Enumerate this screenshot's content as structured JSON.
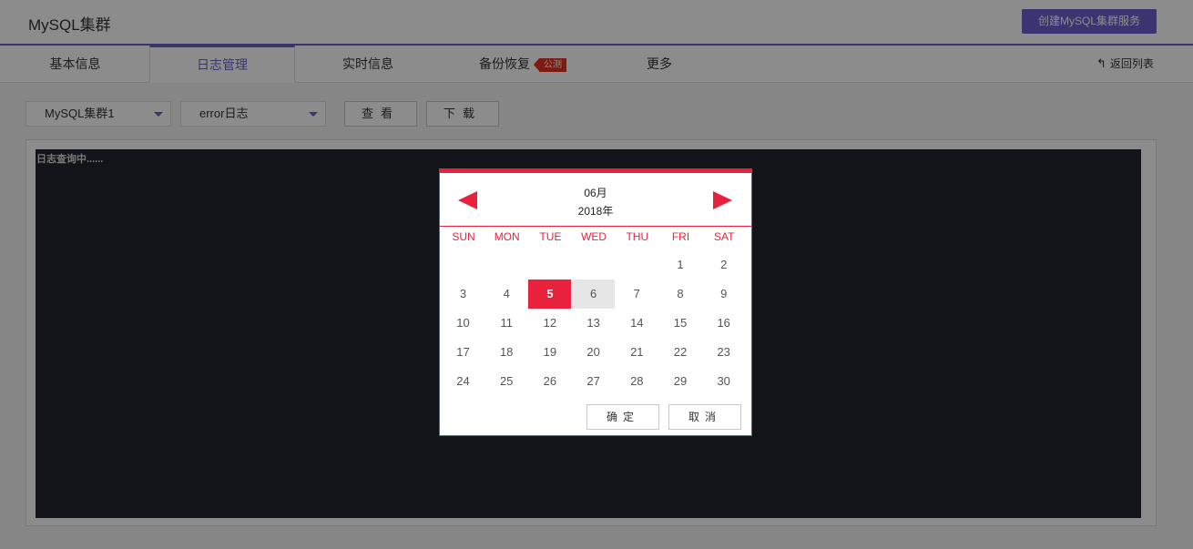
{
  "header": {
    "title": "MySQL集群",
    "create_button": "创建MySQL集群服务"
  },
  "tabs": [
    {
      "label": "基本信息",
      "active": false
    },
    {
      "label": "日志管理",
      "active": true
    },
    {
      "label": "实时信息",
      "active": false
    },
    {
      "label": "备份恢复",
      "active": false,
      "badge": "公测"
    },
    {
      "label": "更多",
      "active": false
    }
  ],
  "back_link": {
    "icon": "return-arrow-icon",
    "label": "返回列表"
  },
  "toolbar": {
    "cluster_select": "MySQL集群1",
    "log_type_select": "error日志",
    "view_button": "查看",
    "download_button": "下载"
  },
  "log": {
    "status_text": "日志查询中......"
  },
  "colors": {
    "accent": "#6b63c6",
    "calendar_red": "#e8223c",
    "log_bg": "#242631"
  },
  "calendar": {
    "month": "06月",
    "year": "2018年",
    "weekdays": [
      "SUN",
      "MON",
      "TUE",
      "WED",
      "THU",
      "FRI",
      "SAT"
    ],
    "weeks": [
      [
        "",
        "",
        "",
        "",
        "",
        "1",
        "2"
      ],
      [
        "3",
        "4",
        "5",
        "6",
        "7",
        "8",
        "9"
      ],
      [
        "10",
        "11",
        "12",
        "13",
        "14",
        "15",
        "16"
      ],
      [
        "17",
        "18",
        "19",
        "20",
        "21",
        "22",
        "23"
      ],
      [
        "24",
        "25",
        "26",
        "27",
        "28",
        "29",
        "30"
      ]
    ],
    "selected_day": "5",
    "hover_day": "6",
    "confirm_button": "确定",
    "cancel_button": "取消"
  }
}
